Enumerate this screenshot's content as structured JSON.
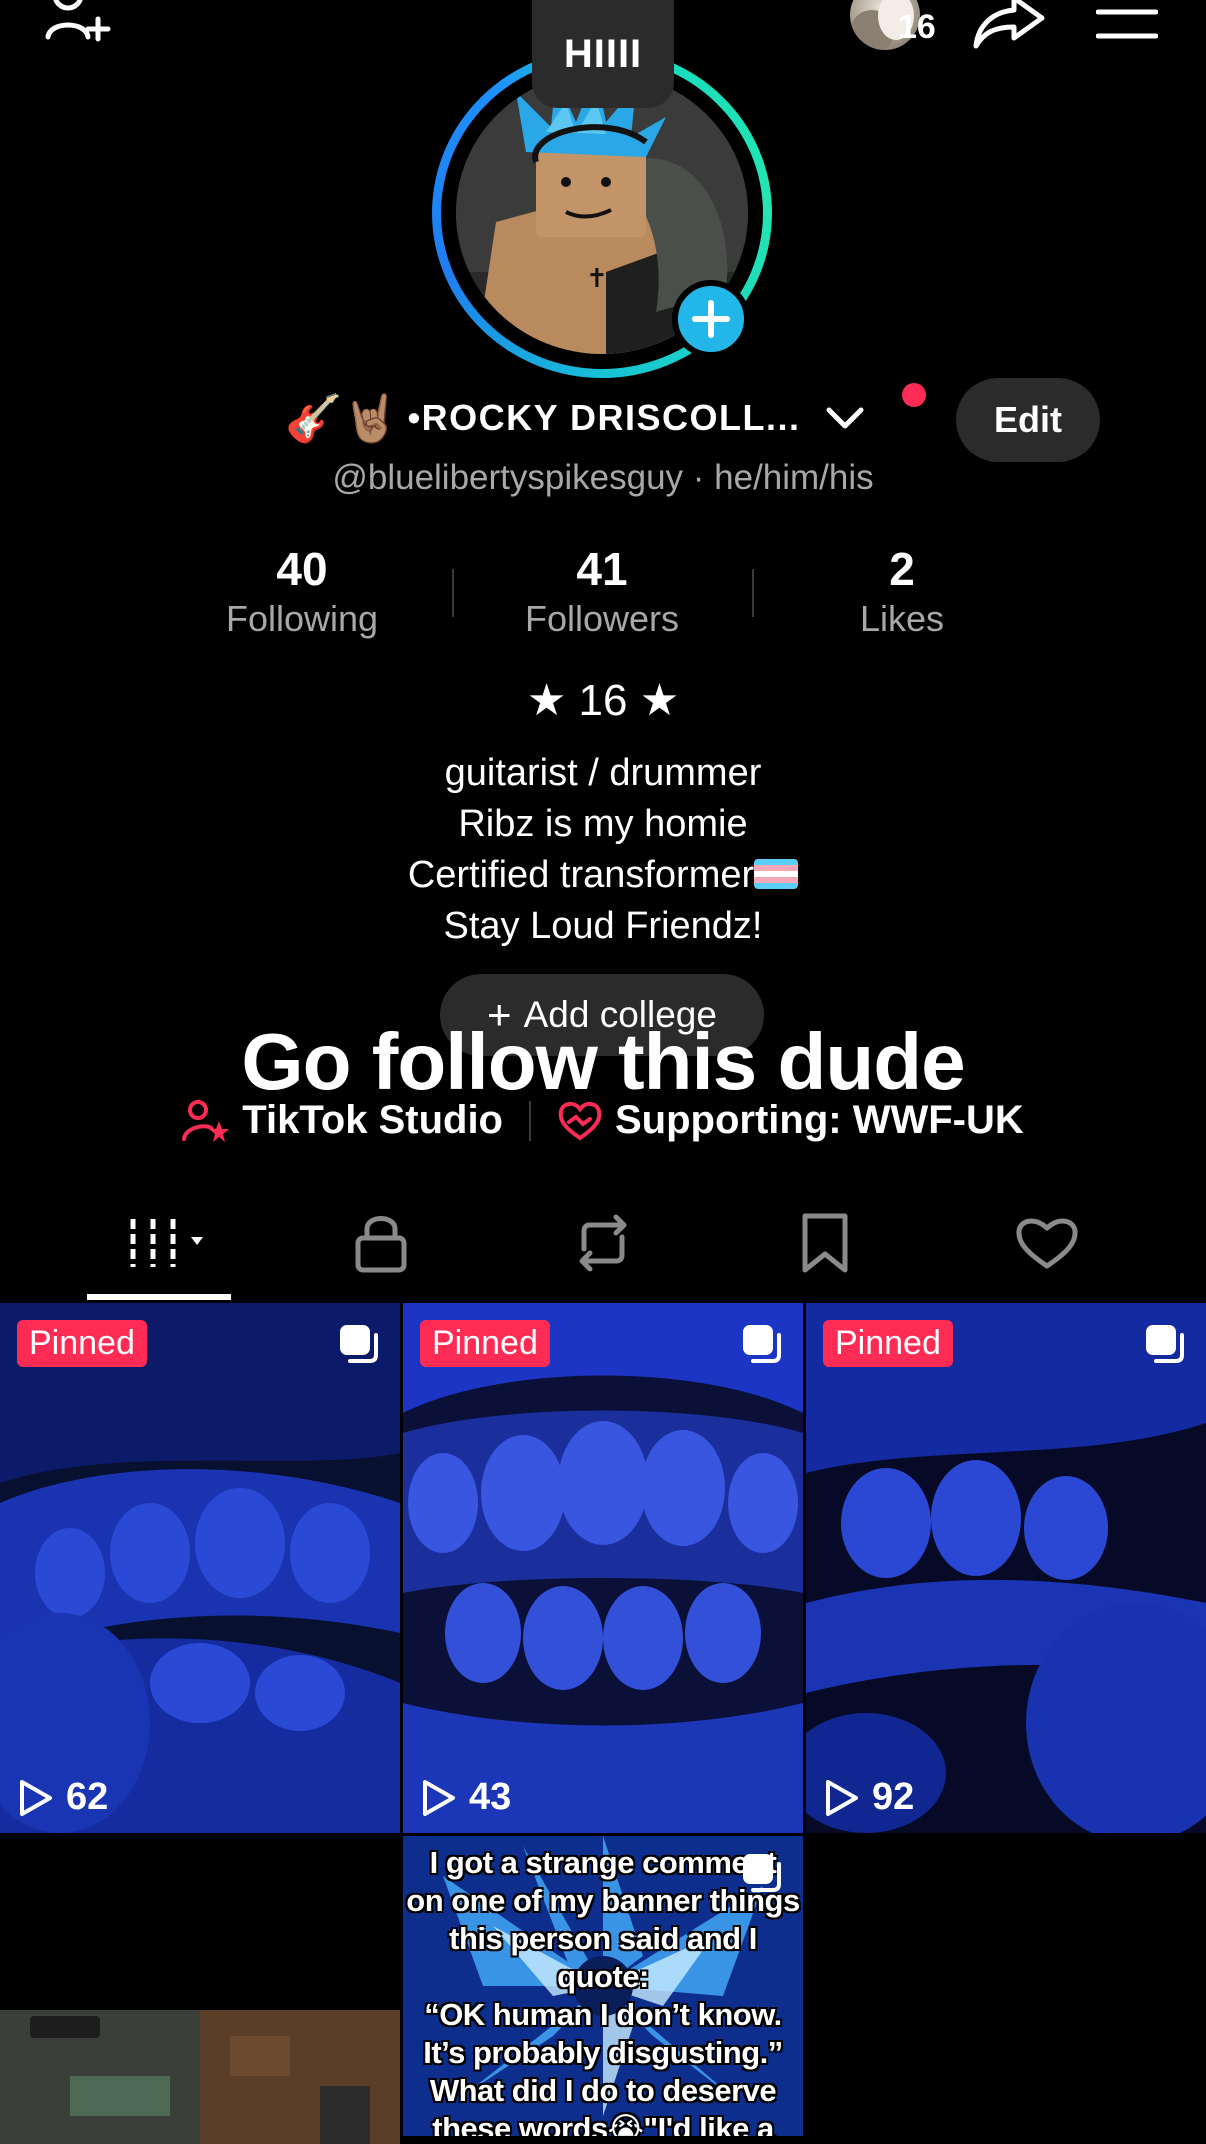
{
  "header": {
    "story_count": "16"
  },
  "profile": {
    "note": "HIIII",
    "emojis": "🎸🤘🏽",
    "display_name": "•ROCKY DRISCOLL...",
    "edit_label": "Edit",
    "handle": "@bluelibertyspikesguy · he/him/his"
  },
  "stats": {
    "following": {
      "value": "40",
      "label": "Following"
    },
    "followers": {
      "value": "41",
      "label": "Followers"
    },
    "likes": {
      "value": "2",
      "label": "Likes"
    }
  },
  "stars_line": "★ 16 ★",
  "bio": {
    "line1": "guitarist / drummer",
    "line2": "Ribz is my homie",
    "line3": "Certified transformer",
    "line4": "Stay Loud Friendz!"
  },
  "add_college": {
    "plus": "+",
    "label": "Add college"
  },
  "overlay_caption": "Go follow this dude",
  "links": {
    "studio": "TikTok Studio",
    "supporting": "Supporting: WWF-UK"
  },
  "videos": [
    {
      "pinned": "Pinned",
      "views": "62"
    },
    {
      "pinned": "Pinned",
      "views": "43"
    },
    {
      "pinned": "Pinned",
      "views": "92"
    }
  ],
  "caption_tile": {
    "text": "I got a strange comment\non one of my banner things\nthis person said and I\nquote:\n“OK human I don’t know.\nIt’s probably disgusting.”\nWhat did I do to deserve\nthese words😭\"I'd like a kind"
  },
  "colors": {
    "accent_red": "#fe2c55",
    "avatar_ring_start": "#1e90ff",
    "avatar_ring_end": "#14d9c4",
    "add_button_blue": "#22b7e8",
    "teeth_blue": "#1f3fc4"
  },
  "icons": {
    "header_left": "add-user-icon",
    "header_share": "share-icon",
    "header_menu": "menu-icon",
    "tab_videos": "grid-icon",
    "tab_private": "lock-icon",
    "tab_reposts": "repost-icon",
    "tab_favorites": "bookmark-icon",
    "tab_liked": "heart-icon"
  }
}
